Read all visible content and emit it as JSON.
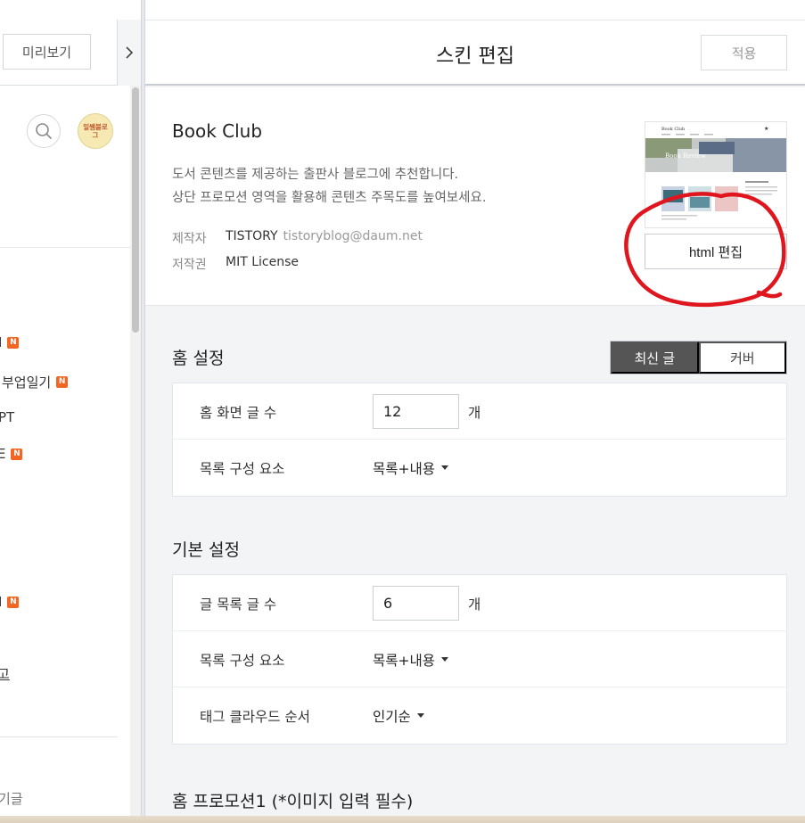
{
  "left_pane": {
    "preview_label": "미리보기",
    "avatar_text": "일쌤블로그",
    "nav_items": [
      {
        "label": "I",
        "badge": "N"
      },
      {
        "label": "부업일기",
        "badge": "N"
      },
      {
        "label": "PT",
        "badge": ""
      },
      {
        "label": "E",
        "badge": "N"
      },
      {
        "label": "I",
        "badge": "N"
      },
      {
        "label": "고",
        "badge": ""
      },
      {
        "label": "기글",
        "badge": ""
      }
    ]
  },
  "header": {
    "title": "스킨 편집",
    "apply_label": "적용"
  },
  "skin": {
    "name": "Book Club",
    "description_line1": "도서 콘텐츠를 제공하는 출판사 블로그에 추천합니다.",
    "description_line2": "상단 프로모션 영역을 활용해 콘텐츠 주목도를 높여보세요.",
    "maker_key": "제작자",
    "maker_value": "TISTORY",
    "maker_email": "tistoryblog@daum.net",
    "license_key": "저작권",
    "license_value": "MIT License",
    "html_edit_label": "html 편집",
    "thumbnail": {
      "site_title": "Book Club",
      "banner_text": "Book Review"
    }
  },
  "home_settings": {
    "title": "홈 설정",
    "tabs": [
      {
        "label": "최신 글",
        "active": true
      },
      {
        "label": "커버",
        "active": false
      }
    ],
    "rows": {
      "post_count_label": "홈 화면 글 수",
      "post_count_value": "12",
      "post_count_unit": "개",
      "list_components_label": "목록 구성 요소",
      "list_components_value": "목록+내용"
    }
  },
  "basic_settings": {
    "title": "기본 설정",
    "rows": {
      "list_count_label": "글 목록 글 수",
      "list_count_value": "6",
      "list_count_unit": "개",
      "list_components_label": "목록 구성 요소",
      "list_components_value": "목록+내용",
      "tag_cloud_label": "태그 클라우드 순서",
      "tag_cloud_value": "인기순"
    }
  },
  "home_promotion": {
    "title": "홈 프로모션1 (*이미지 입력 필수)"
  },
  "colors": {
    "annotation_red": "#e0161e",
    "badge_orange": "#f26522",
    "segment_active": "#555555"
  }
}
